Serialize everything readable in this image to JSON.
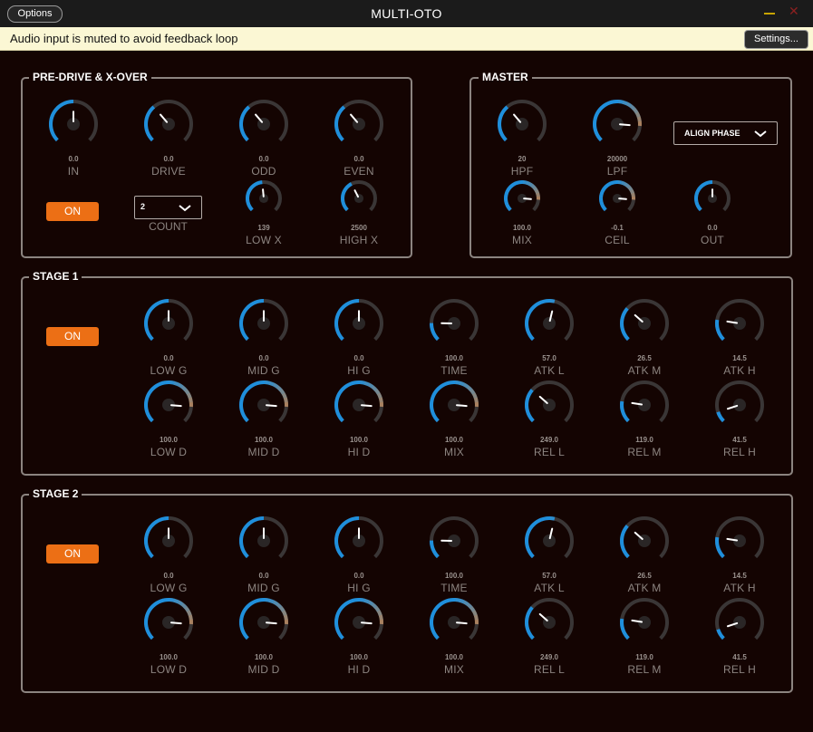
{
  "window": {
    "title": "MULTI-OTO",
    "options_label": "Options"
  },
  "notice": {
    "text": "Audio input is muted to avoid feedback loop",
    "settings_label": "Settings..."
  },
  "colors": {
    "arc_low": "#1f8fdc",
    "arc_high": "#f07a20",
    "track": "#3a3636",
    "label": "#8c8480",
    "on_button": "#ec6f15"
  },
  "predrive": {
    "title": "PRE-DRIVE & X-OVER",
    "on_label": "ON",
    "count": {
      "value": "2",
      "label": "COUNT"
    },
    "knobs": [
      {
        "value": "0.0",
        "label": "IN",
        "level": 0.5
      },
      {
        "value": "0.0",
        "label": "DRIVE",
        "level": 0.35
      },
      {
        "value": "0.0",
        "label": "ODD",
        "level": 0.35
      },
      {
        "value": "0.0",
        "label": "EVEN",
        "level": 0.35
      },
      {
        "value": "139",
        "label": "LOW X",
        "level": 0.48
      },
      {
        "value": "2500",
        "label": "HIGH X",
        "level": 0.4
      }
    ]
  },
  "master": {
    "title": "MASTER",
    "align_label": "ALIGN PHASE",
    "knobs": [
      {
        "value": "20",
        "label": "HPF",
        "level": 0.35
      },
      {
        "value": "20000",
        "label": "LPF",
        "level": 0.85
      },
      {
        "value": "100.0",
        "label": "MIX",
        "level": 0.85
      },
      {
        "value": "-0.1",
        "label": "CEIL",
        "level": 0.85
      },
      {
        "value": "0.0",
        "label": "OUT",
        "level": 0.5
      }
    ]
  },
  "stage1": {
    "title": "STAGE 1",
    "on_label": "ON",
    "row1": [
      {
        "value": "0.0",
        "label": "LOW G",
        "level": 0.5
      },
      {
        "value": "0.0",
        "label": "MID G",
        "level": 0.5
      },
      {
        "value": "0.0",
        "label": "HI G",
        "level": 0.5
      },
      {
        "value": "100.0",
        "label": "TIME",
        "level": 0.17
      },
      {
        "value": "57.0",
        "label": "ATK L",
        "level": 0.55
      },
      {
        "value": "26.5",
        "label": "ATK M",
        "level": 0.32
      },
      {
        "value": "14.5",
        "label": "ATK H",
        "level": 0.2
      }
    ],
    "row2": [
      {
        "value": "100.0",
        "label": "LOW D",
        "level": 0.85
      },
      {
        "value": "100.0",
        "label": "MID D",
        "level": 0.85
      },
      {
        "value": "100.0",
        "label": "HI D",
        "level": 0.85
      },
      {
        "value": "100.0",
        "label": "MIX",
        "level": 0.85
      },
      {
        "value": "249.0",
        "label": "REL L",
        "level": 0.32
      },
      {
        "value": "119.0",
        "label": "REL M",
        "level": 0.2
      },
      {
        "value": "41.5",
        "label": "REL H",
        "level": 0.1
      }
    ]
  },
  "stage2": {
    "title": "STAGE 2",
    "on_label": "ON",
    "row1": [
      {
        "value": "0.0",
        "label": "LOW G",
        "level": 0.5
      },
      {
        "value": "0.0",
        "label": "MID G",
        "level": 0.5
      },
      {
        "value": "0.0",
        "label": "HI G",
        "level": 0.5
      },
      {
        "value": "100.0",
        "label": "TIME",
        "level": 0.17
      },
      {
        "value": "57.0",
        "label": "ATK L",
        "level": 0.55
      },
      {
        "value": "26.5",
        "label": "ATK M",
        "level": 0.32
      },
      {
        "value": "14.5",
        "label": "ATK H",
        "level": 0.2
      }
    ],
    "row2": [
      {
        "value": "100.0",
        "label": "LOW D",
        "level": 0.85
      },
      {
        "value": "100.0",
        "label": "MID D",
        "level": 0.85
      },
      {
        "value": "100.0",
        "label": "HI D",
        "level": 0.85
      },
      {
        "value": "100.0",
        "label": "MIX",
        "level": 0.85
      },
      {
        "value": "249.0",
        "label": "REL L",
        "level": 0.32
      },
      {
        "value": "119.0",
        "label": "REL M",
        "level": 0.2
      },
      {
        "value": "41.5",
        "label": "REL H",
        "level": 0.1
      }
    ]
  }
}
